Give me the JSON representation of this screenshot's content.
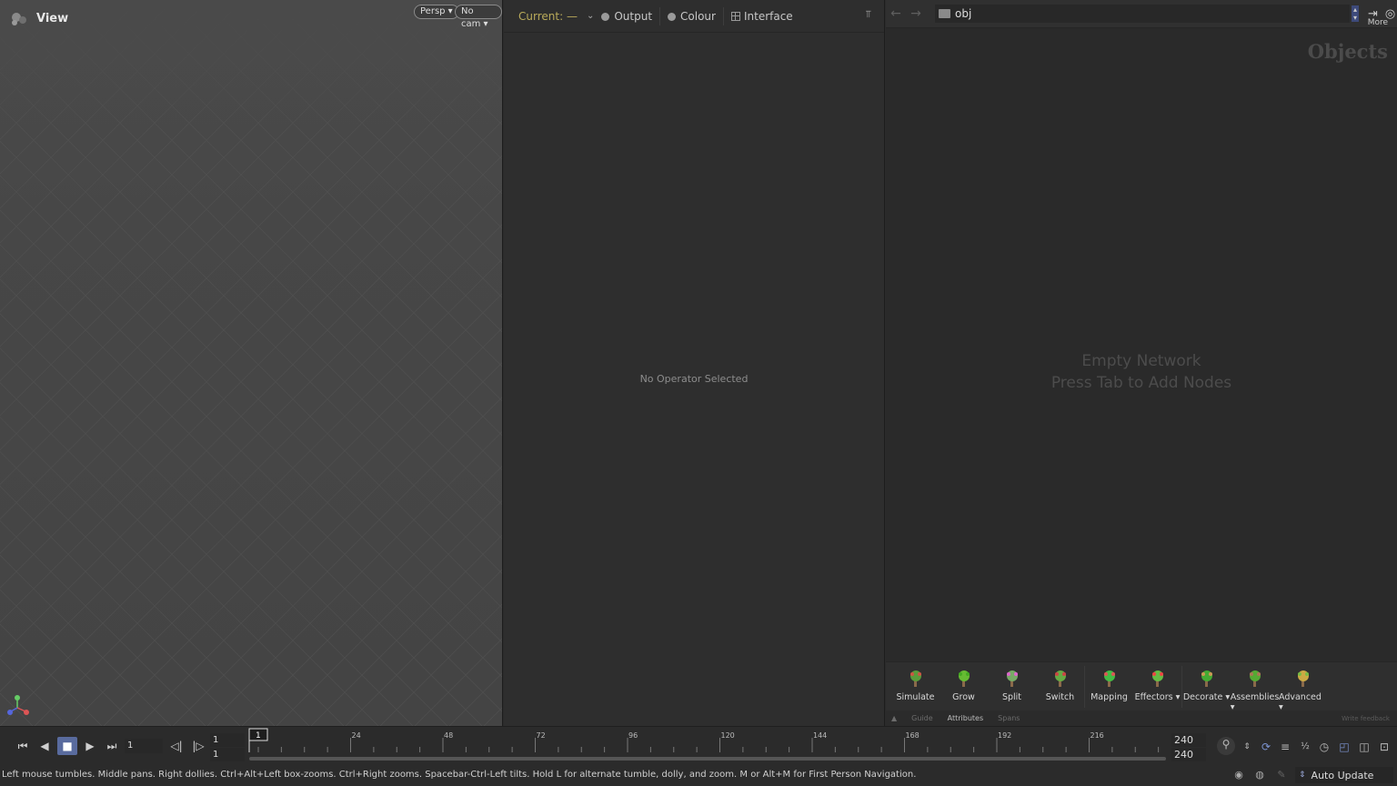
{
  "viewport": {
    "title": "View",
    "persp_label": "Persp",
    "cam_label": "No cam"
  },
  "params": {
    "current_label": "Current:",
    "current_value": "—",
    "output_label": "Output",
    "colour_label": "Colour",
    "interface_label": "Interface",
    "no_operator": "No Operator Selected"
  },
  "network": {
    "path": "obj",
    "context_label": "Objects",
    "empty_line1": "Empty Network",
    "empty_line2": "Press Tab to Add Nodes",
    "shelf_tools": [
      {
        "label": "Simulate",
        "icon": "simulate-icon"
      },
      {
        "label": "Grow",
        "icon": "grow-icon"
      },
      {
        "label": "Split",
        "icon": "split-icon"
      },
      {
        "label": "Switch",
        "icon": "switch-icon"
      },
      {
        "label": "Mapping",
        "icon": "mapping-icon"
      },
      {
        "label": "Effectors ▾",
        "icon": "effectors-icon"
      },
      {
        "label": "Decorate ▾",
        "icon": "decorate-icon"
      },
      {
        "label": "Assemblies ▾",
        "icon": "assemblies-icon"
      },
      {
        "label": "Advanced ▾",
        "icon": "advanced-icon"
      }
    ],
    "more_label": "More",
    "shelf_tabs": [
      "Guide",
      "Attributes",
      "Spans"
    ],
    "feedback_label": "Write feedback"
  },
  "timeline": {
    "current_frame": "1",
    "start_frame": "1",
    "range_start": "1",
    "end_frame": "240",
    "range_end": "240",
    "playhead_frame": "1",
    "ticks": [
      "24",
      "48",
      "72",
      "96",
      "120",
      "144",
      "168",
      "192",
      "216",
      "24"
    ]
  },
  "status": {
    "message": "Left mouse tumbles. Middle pans. Right dollies. Ctrl+Alt+Left box-zooms. Ctrl+Right zooms. Spacebar-Ctrl-Left tilts. Hold L for alternate tumble, dolly, and zoom. M or Alt+M for First Person Navigation.",
    "auto_update": "Auto Update"
  }
}
